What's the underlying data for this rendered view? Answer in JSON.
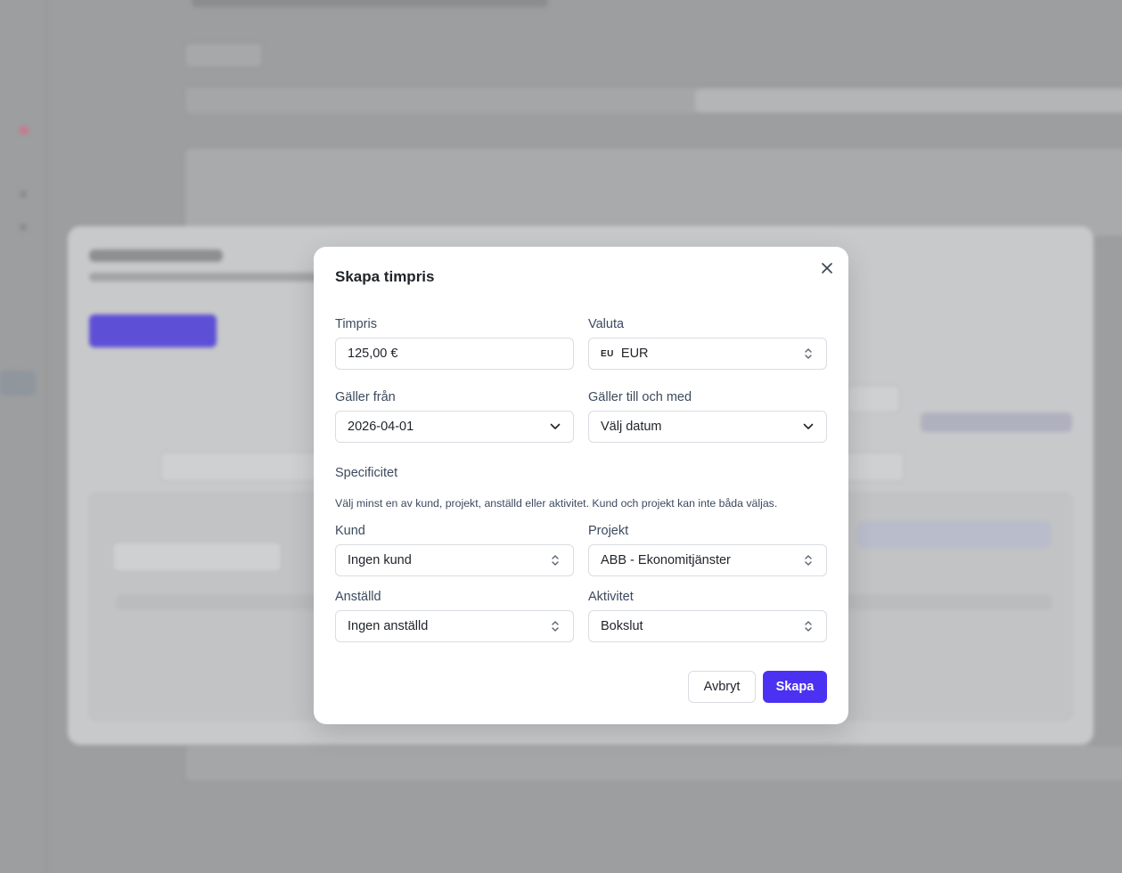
{
  "dialog": {
    "title": "Skapa timpris",
    "close_icon": "close-icon",
    "fields": {
      "rate": {
        "label": "Timpris",
        "value": "125,00 €"
      },
      "currency": {
        "label": "Valuta",
        "flag": "EU",
        "value": "EUR"
      },
      "valid_from": {
        "label": "Gäller från",
        "value": "2026-04-01"
      },
      "valid_to": {
        "label": "Gäller till och med",
        "value": "Välj datum"
      },
      "customer": {
        "label": "Kund",
        "value": "Ingen kund"
      },
      "project": {
        "label": "Projekt",
        "value": "ABB - Ekonomitjänster"
      },
      "employee": {
        "label": "Anställd",
        "value": "Ingen anställd"
      },
      "activity": {
        "label": "Aktivitet",
        "value": "Bokslut"
      }
    },
    "specificity": {
      "title": "Specificitet",
      "hint": "Välj minst en av kund, projekt, anställd eller aktivitet. Kund och projekt kan inte båda väljas."
    },
    "buttons": {
      "cancel": "Avbryt",
      "create": "Skapa"
    }
  },
  "colors": {
    "accent": "#4b31f2",
    "overlay": "#9d9e9f",
    "label": "#3c4a5e",
    "text": "#1f2328"
  }
}
